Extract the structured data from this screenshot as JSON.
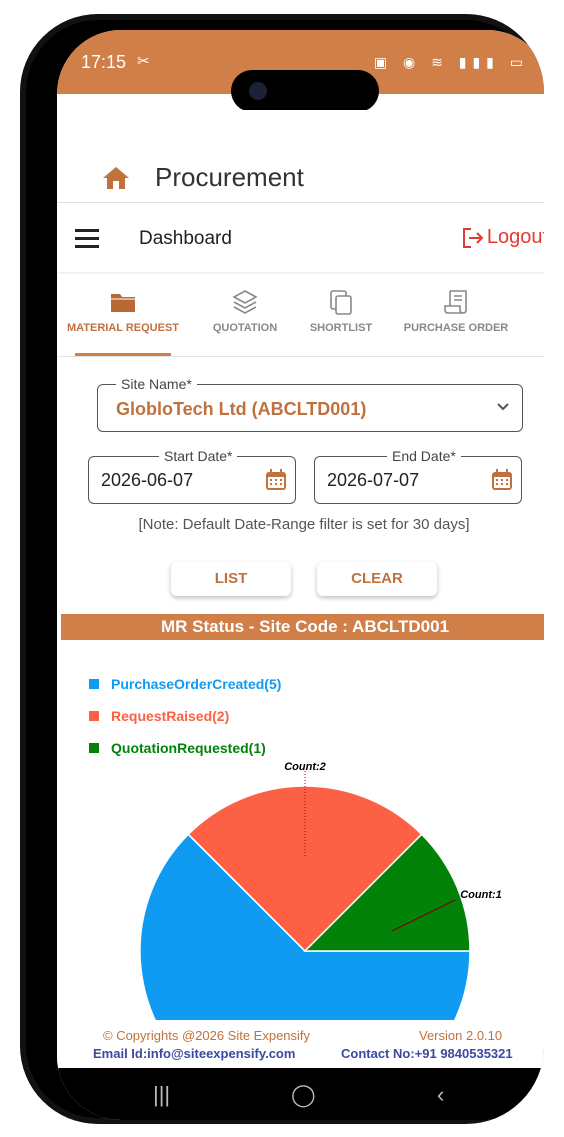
{
  "status_bar": {
    "time": "17:15",
    "icons": "▣ ◉ ≋ ▮▮▮ ▭"
  },
  "header": {
    "title": "Procurement"
  },
  "dashbar": {
    "title": "Dashboard",
    "logout_label": "Logout"
  },
  "tabs": [
    {
      "label": "MATERIAL REQUEST",
      "icon": "folder-icon",
      "active": true
    },
    {
      "label": "QUOTATION",
      "icon": "layers-icon",
      "active": false
    },
    {
      "label": "SHORTLIST",
      "icon": "copy-icon",
      "active": false
    },
    {
      "label": "PURCHASE ORDER",
      "icon": "receipt-icon",
      "active": false
    }
  ],
  "filters": {
    "site_label": "Site Name*",
    "site_value": "GlobloTech Ltd (ABCLTD001)",
    "start_label": "Start Date*",
    "start_value": "2026-06-07",
    "end_label": "End Date*",
    "end_value": "2026-07-07",
    "note": "[Note: Default Date-Range filter is set for 30 days]"
  },
  "buttons": {
    "list": "LIST",
    "clear": "CLEAR"
  },
  "status_title": "MR Status - Site Code : ABCLTD001",
  "chart_data": {
    "type": "pie",
    "labels": [
      "PurchaseOrderCreated(5)",
      "RequestRaised(2)",
      "QuotationRequested(1)"
    ],
    "values": [
      5,
      2,
      1
    ],
    "colors": [
      "#0f9bf2",
      "#fd6145",
      "#03820a"
    ],
    "annotations": [
      "Count:2",
      "Count:1"
    ]
  },
  "footer": {
    "copyright": "© Copyrights @2026 Site Expensify",
    "version": "Version 2.0.10",
    "email": "Email Id:info@siteexpensify.com",
    "contact": "Contact No:+91 9840535321"
  },
  "colors": {
    "accent": "#cf7f47",
    "accent_text": "#c0713e",
    "logout": "#e53935"
  }
}
